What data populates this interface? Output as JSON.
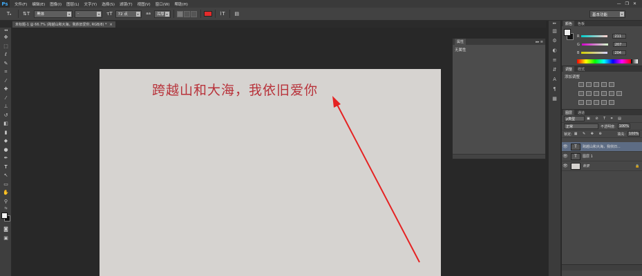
{
  "app": {
    "logo": "Ps",
    "menu": [
      "文件(F)",
      "编辑(E)",
      "图像(I)",
      "图层(L)",
      "文字(Y)",
      "选择(S)",
      "滤镜(T)",
      "视图(V)",
      "窗口(W)",
      "帮助(H)"
    ],
    "window_controls": {
      "minimize": "—",
      "restore": "❐",
      "close": "✕"
    }
  },
  "options": {
    "font_family": "黑体",
    "font_style": "-",
    "font_size": "72 点",
    "antialias_label": "aa",
    "antialias": "浑厚",
    "text_color": "#e32b2b",
    "workspace": "基本功能"
  },
  "document": {
    "tab_label": "未标题-1 @ 66.7% (跨越山和大海，我依旧爱你, RGB/8) *",
    "tab_close": "×",
    "text": "跨越山和大海，我依旧爱你",
    "canvas_color": "#d6d3d0",
    "text_color": "#b8323a"
  },
  "properties": {
    "tab": "属性",
    "content": "无属性"
  },
  "color_panel": {
    "tabs": [
      "颜色",
      "色板"
    ],
    "r_label": "R",
    "r": "211",
    "g_label": "G",
    "g": "207",
    "b_label": "B",
    "b": "204"
  },
  "adjustments": {
    "tabs": [
      "调整",
      "样式"
    ],
    "title": "添加调整"
  },
  "layers": {
    "tabs": [
      "图层",
      "通道"
    ],
    "filter": "ρ类型",
    "blend_mode": "正常",
    "opacity_label": "不透明度:",
    "opacity": "100%",
    "lock_label": "锁定:",
    "fill_label": "填充:",
    "fill": "100%",
    "items": [
      {
        "name": "跨越山和大海，我依旧...",
        "type": "T",
        "selected": true
      },
      {
        "name": "图层 1",
        "type": "T",
        "selected": false
      },
      {
        "name": "背景",
        "type": "",
        "selected": false
      }
    ]
  }
}
